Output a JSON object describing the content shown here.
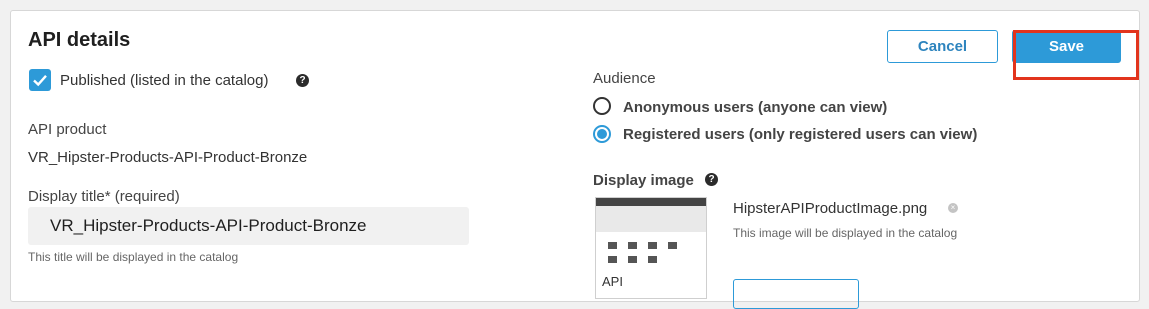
{
  "panel": {
    "title": "API details",
    "published": {
      "label": "Published (listed in the catalog)",
      "checked": true,
      "help_icon": "?"
    },
    "api_product": {
      "label": "API product",
      "value": "VR_Hipster-Products-API-Product-Bronze"
    },
    "display_title": {
      "label": "Display title* (required)",
      "value": "VR_Hipster-Products-API-Product-Bronze",
      "hint": "This title will be displayed in the catalog"
    }
  },
  "actions": {
    "cancel_label": "Cancel",
    "save_label": "Save"
  },
  "audience": {
    "label": "Audience",
    "options": [
      {
        "label": "Anonymous users (anyone can view)",
        "selected": false
      },
      {
        "label": "Registered users (only registered users can view)",
        "selected": true
      }
    ]
  },
  "display_image": {
    "label": "Display image",
    "help_icon": "?",
    "file_name": "HipsterAPIProductImage.png",
    "hint": "This image will be displayed in the catalog",
    "thumbnail_caption": "API"
  },
  "colors": {
    "accent": "#2d9ad8",
    "highlight": "#e2341d"
  }
}
